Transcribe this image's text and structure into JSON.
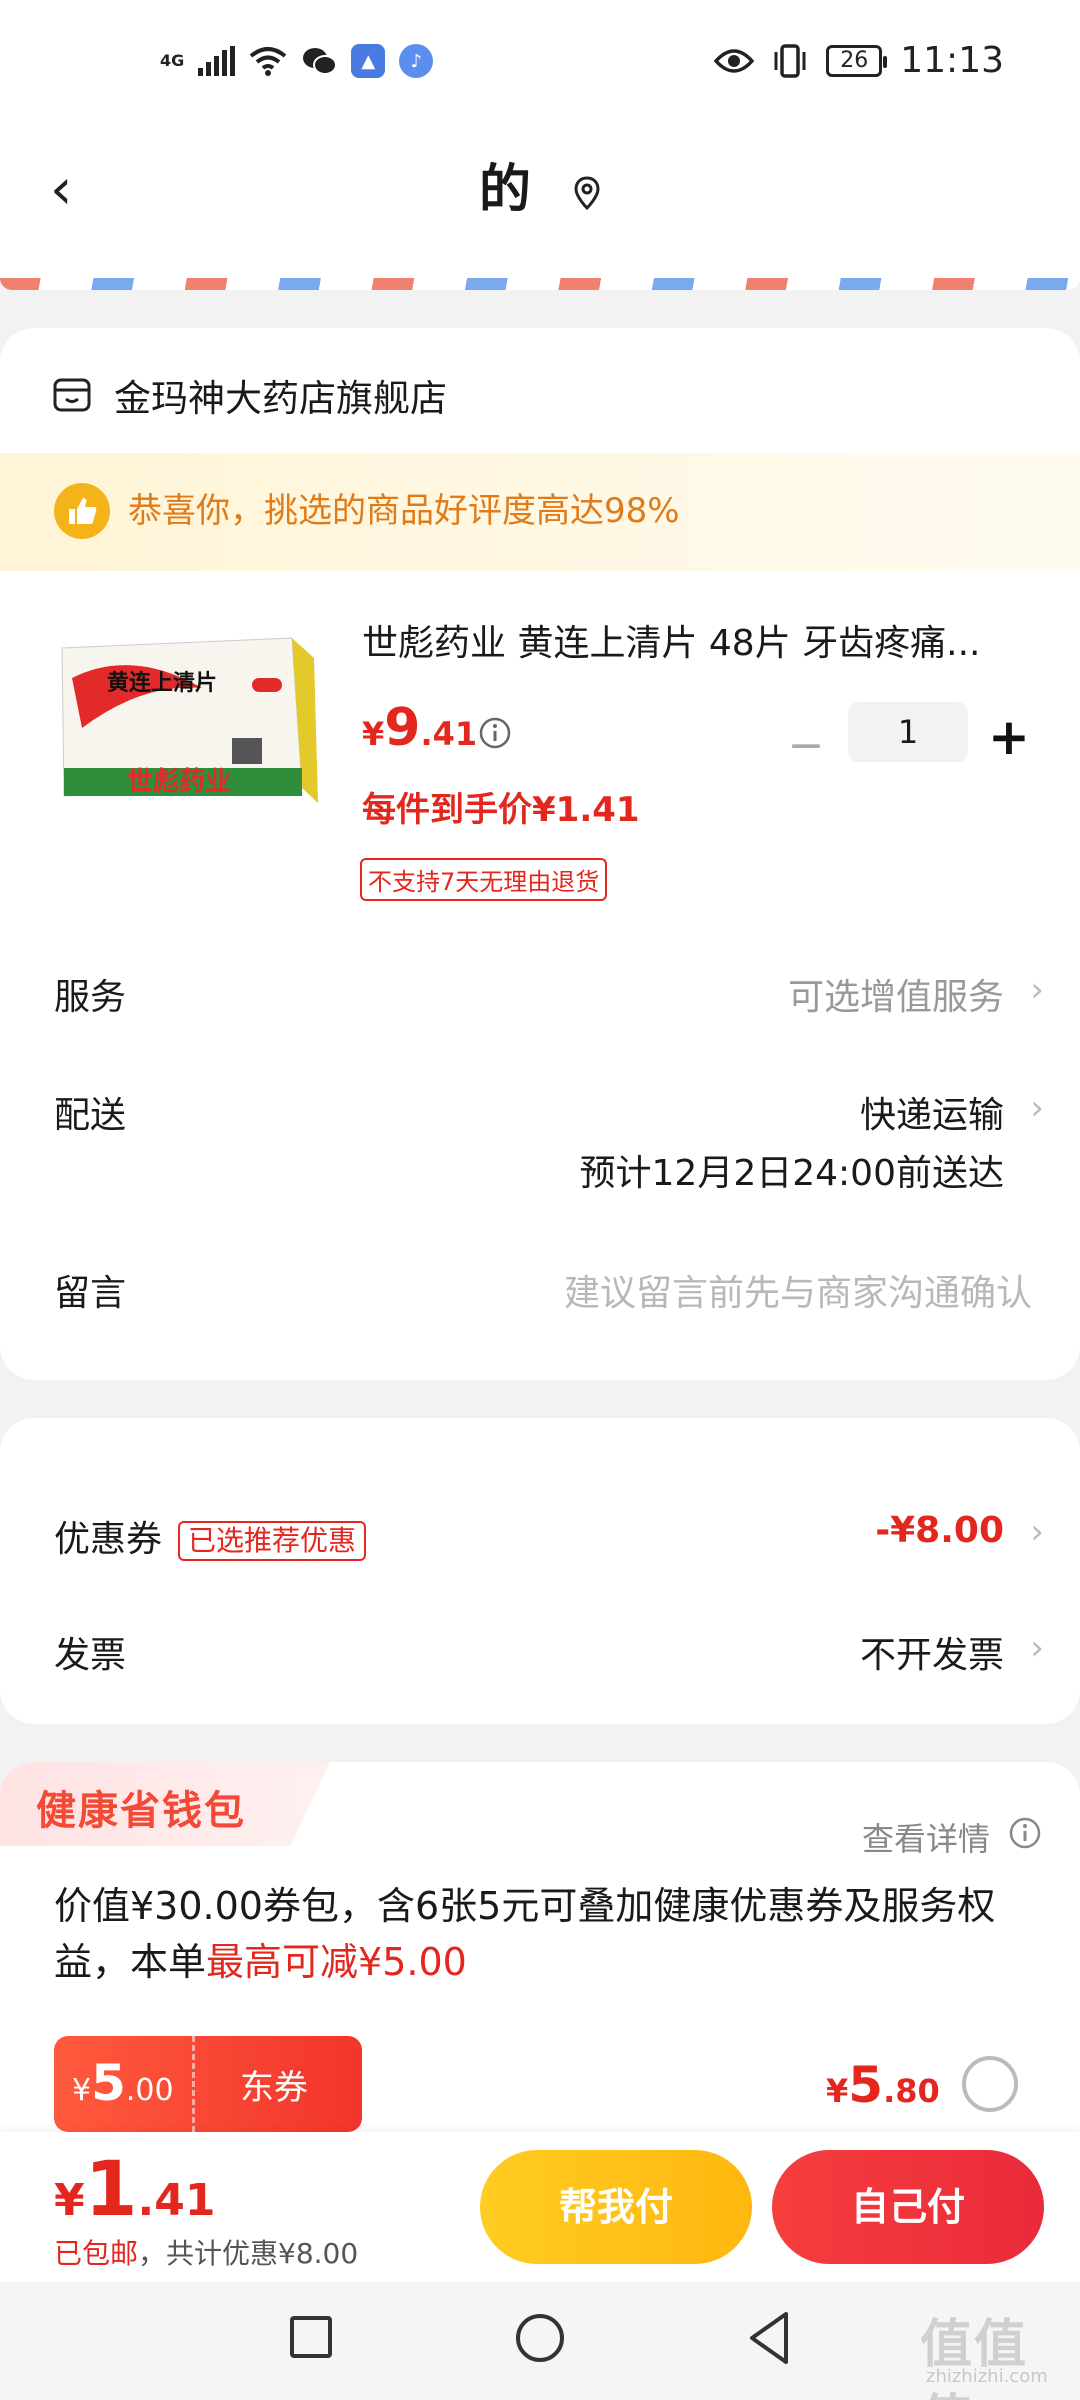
{
  "status_bar": {
    "network": "4G",
    "battery": "26",
    "time": "11:13"
  },
  "header": {
    "title": "的"
  },
  "store": {
    "name": "金玛神大药店旗舰店"
  },
  "praise_banner": {
    "text": "恭喜你，挑选的商品好评度高达98%"
  },
  "product": {
    "title": "世彪药业 黄连上清片 48片 牙齿疼痛...",
    "price_currency": "¥",
    "price_int": "9",
    "price_dec": ".41",
    "quantity": "1",
    "minus_label": "−",
    "plus_label": "+",
    "unit_price": "每件到手价¥1.41",
    "return_tag": "不支持7天无理由退货"
  },
  "rows": {
    "service_label": "服务",
    "service_value": "可选增值服务",
    "delivery_label": "配送",
    "delivery_value": "快递运输",
    "delivery_eta": "预计12月2日24:00前送达",
    "message_label": "留言",
    "message_placeholder": "建议留言前先与商家沟通确认"
  },
  "discounts": {
    "coupon_label": "优惠券",
    "coupon_tag": "已选推荐优惠",
    "coupon_value": "-¥8.00",
    "invoice_label": "发票",
    "invoice_value": "不开发票"
  },
  "wallet": {
    "title": "健康省钱包",
    "view_detail": "查看详情",
    "desc_prefix": "价值¥30.00券包，含6张5元可叠加健康优惠券及服务权益，本单",
    "desc_highlight": "最高可减¥5.00",
    "coupon_currency": "¥",
    "coupon_int": "5",
    "coupon_dec": ".00",
    "coupon_label": "东券",
    "price_currency": "¥",
    "price_int": "5",
    "price_dec": ".80",
    "selected": false
  },
  "bottom_bar": {
    "total_currency": "¥",
    "total_int": "1",
    "total_dec": ".41",
    "note_shipping": "已包邮",
    "note_savings": "，共计优惠¥8.00",
    "help_pay_label": "帮我付",
    "self_pay_label": "自己付"
  },
  "watermark": {
    "text": "值值值",
    "url": "zhizhizhi.com"
  },
  "colors": {
    "accent_red": "#e4271e",
    "help_yellow": "#ffbb12",
    "praise_orange": "#e07b1a"
  }
}
